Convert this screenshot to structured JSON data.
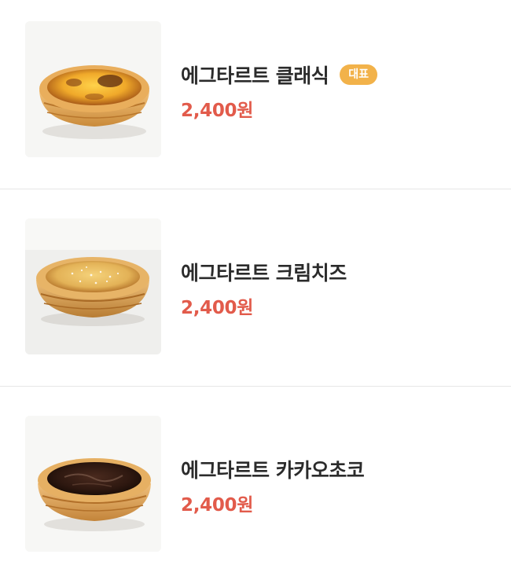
{
  "menu": {
    "items": [
      {
        "name": "에그타르트 클래식",
        "badge": "대표",
        "price": "2,400원",
        "icon": "egg-tart-classic-photo"
      },
      {
        "name": "에그타르트 크림치즈",
        "price": "2,400원",
        "icon": "egg-tart-cream-cheese-photo"
      },
      {
        "name": "에그타르트 카카오초코",
        "price": "2,400원",
        "icon": "egg-tart-cacao-choco-photo"
      }
    ]
  },
  "colors": {
    "price": "#e25b4b",
    "badge_bg": "#f2b24a",
    "divider": "#e6e6e6"
  }
}
